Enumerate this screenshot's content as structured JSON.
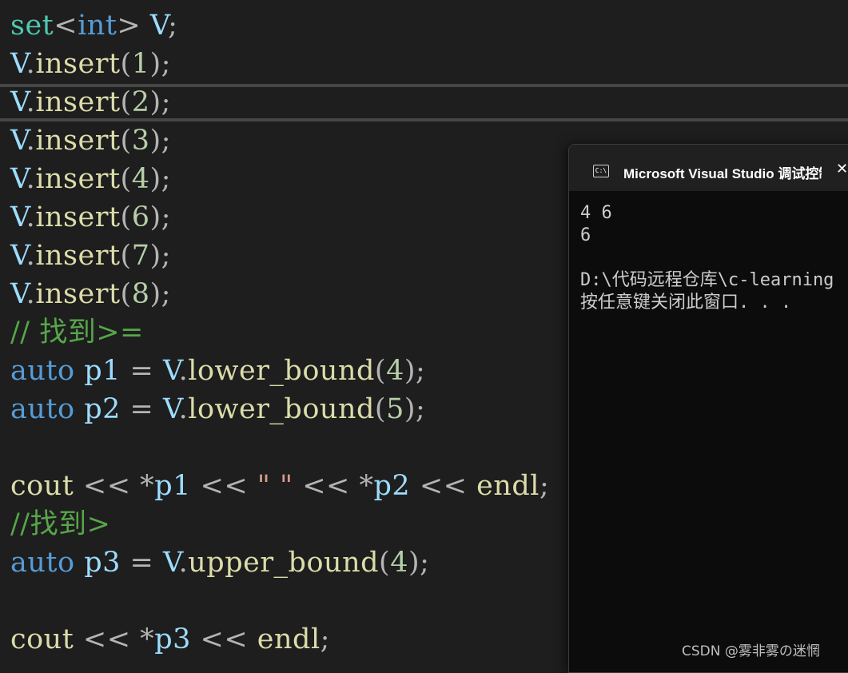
{
  "editor": {
    "lines": [
      [
        {
          "t": "set",
          "c": "ty"
        },
        {
          "t": "<",
          "c": "op"
        },
        {
          "t": "int",
          "c": "kw"
        },
        {
          "t": "> ",
          "c": "op"
        },
        {
          "t": "V",
          "c": "vr"
        },
        {
          "t": ";",
          "c": "op"
        }
      ],
      [
        {
          "t": "V",
          "c": "vr"
        },
        {
          "t": ".",
          "c": "op"
        },
        {
          "t": "insert",
          "c": "fn"
        },
        {
          "t": "(",
          "c": "op"
        },
        {
          "t": "1",
          "c": "nm"
        },
        {
          "t": ");",
          "c": "op"
        }
      ],
      [
        {
          "t": "V",
          "c": "vr"
        },
        {
          "t": ".",
          "c": "op"
        },
        {
          "t": "insert",
          "c": "fn"
        },
        {
          "t": "(",
          "c": "op"
        },
        {
          "t": "2",
          "c": "nm"
        },
        {
          "t": ");",
          "c": "op"
        }
      ],
      [
        {
          "t": "V",
          "c": "vr"
        },
        {
          "t": ".",
          "c": "op"
        },
        {
          "t": "insert",
          "c": "fn"
        },
        {
          "t": "(",
          "c": "op"
        },
        {
          "t": "3",
          "c": "nm"
        },
        {
          "t": ");",
          "c": "op"
        }
      ],
      [
        {
          "t": "V",
          "c": "vr"
        },
        {
          "t": ".",
          "c": "op"
        },
        {
          "t": "insert",
          "c": "fn"
        },
        {
          "t": "(",
          "c": "op"
        },
        {
          "t": "4",
          "c": "nm"
        },
        {
          "t": ");",
          "c": "op"
        }
      ],
      [
        {
          "t": "V",
          "c": "vr"
        },
        {
          "t": ".",
          "c": "op"
        },
        {
          "t": "insert",
          "c": "fn"
        },
        {
          "t": "(",
          "c": "op"
        },
        {
          "t": "6",
          "c": "nm"
        },
        {
          "t": ");",
          "c": "op"
        }
      ],
      [
        {
          "t": "V",
          "c": "vr"
        },
        {
          "t": ".",
          "c": "op"
        },
        {
          "t": "insert",
          "c": "fn"
        },
        {
          "t": "(",
          "c": "op"
        },
        {
          "t": "7",
          "c": "nm"
        },
        {
          "t": ");",
          "c": "op"
        }
      ],
      [
        {
          "t": "V",
          "c": "vr"
        },
        {
          "t": ".",
          "c": "op"
        },
        {
          "t": "insert",
          "c": "fn"
        },
        {
          "t": "(",
          "c": "op"
        },
        {
          "t": "8",
          "c": "nm"
        },
        {
          "t": ");",
          "c": "op"
        }
      ],
      [
        {
          "t": "// 找到>=",
          "c": "cm"
        }
      ],
      [
        {
          "t": "auto",
          "c": "kw"
        },
        {
          "t": " ",
          "c": "op"
        },
        {
          "t": "p1",
          "c": "vr"
        },
        {
          "t": " = ",
          "c": "op"
        },
        {
          "t": "V",
          "c": "vr"
        },
        {
          "t": ".",
          "c": "op"
        },
        {
          "t": "lower_bound",
          "c": "fn"
        },
        {
          "t": "(",
          "c": "op"
        },
        {
          "t": "4",
          "c": "nm"
        },
        {
          "t": ");",
          "c": "op"
        }
      ],
      [
        {
          "t": "auto",
          "c": "kw"
        },
        {
          "t": " ",
          "c": "op"
        },
        {
          "t": "p2",
          "c": "vr"
        },
        {
          "t": " = ",
          "c": "op"
        },
        {
          "t": "V",
          "c": "vr"
        },
        {
          "t": ".",
          "c": "op"
        },
        {
          "t": "lower_bound",
          "c": "fn"
        },
        {
          "t": "(",
          "c": "op"
        },
        {
          "t": "5",
          "c": "nm"
        },
        {
          "t": ");",
          "c": "op"
        }
      ],
      [],
      [
        {
          "t": "cout",
          "c": "fn"
        },
        {
          "t": " << *",
          "c": "op"
        },
        {
          "t": "p1",
          "c": "vr"
        },
        {
          "t": " << ",
          "c": "op"
        },
        {
          "t": "\" \"",
          "c": "st"
        },
        {
          "t": " << *",
          "c": "op"
        },
        {
          "t": "p2",
          "c": "vr"
        },
        {
          "t": " << ",
          "c": "op"
        },
        {
          "t": "endl",
          "c": "fn"
        },
        {
          "t": ";",
          "c": "op"
        }
      ],
      [
        {
          "t": "//找到>",
          "c": "cm"
        }
      ],
      [
        {
          "t": "auto",
          "c": "kw"
        },
        {
          "t": " ",
          "c": "op"
        },
        {
          "t": "p3",
          "c": "vr"
        },
        {
          "t": " = ",
          "c": "op"
        },
        {
          "t": "V",
          "c": "vr"
        },
        {
          "t": ".",
          "c": "op"
        },
        {
          "t": "upper_bound",
          "c": "fn"
        },
        {
          "t": "(",
          "c": "op"
        },
        {
          "t": "4",
          "c": "nm"
        },
        {
          "t": ");",
          "c": "op"
        }
      ],
      [],
      [
        {
          "t": "cout",
          "c": "fn"
        },
        {
          "t": " << *",
          "c": "op"
        },
        {
          "t": "p3",
          "c": "vr"
        },
        {
          "t": " << ",
          "c": "op"
        },
        {
          "t": "endl",
          "c": "fn"
        },
        {
          "t": ";",
          "c": "op"
        }
      ]
    ],
    "current_line": 2
  },
  "console": {
    "title": "Microsoft Visual Studio 调试控制台",
    "icon_label": "C:\\",
    "close_glyph": "✕",
    "output": [
      "4 6",
      "6",
      "",
      "D:\\代码远程仓库\\c-learning",
      "按任意键关闭此窗口. . ."
    ]
  },
  "watermark": "CSDN @雾非雾の迷惘",
  "colors": {
    "background": "#1e1e1e",
    "console_background": "#0c0c0c",
    "console_titlebar": "#202020",
    "keyword": "#569cd6",
    "type": "#4ec9b0",
    "variable": "#9cdcfe",
    "function": "#dcdcaa",
    "number": "#b5cea8",
    "comment": "#57a64a",
    "string": "#d69d85"
  },
  "icons": {
    "console_app": "console-app-icon",
    "close": "close-icon"
  }
}
